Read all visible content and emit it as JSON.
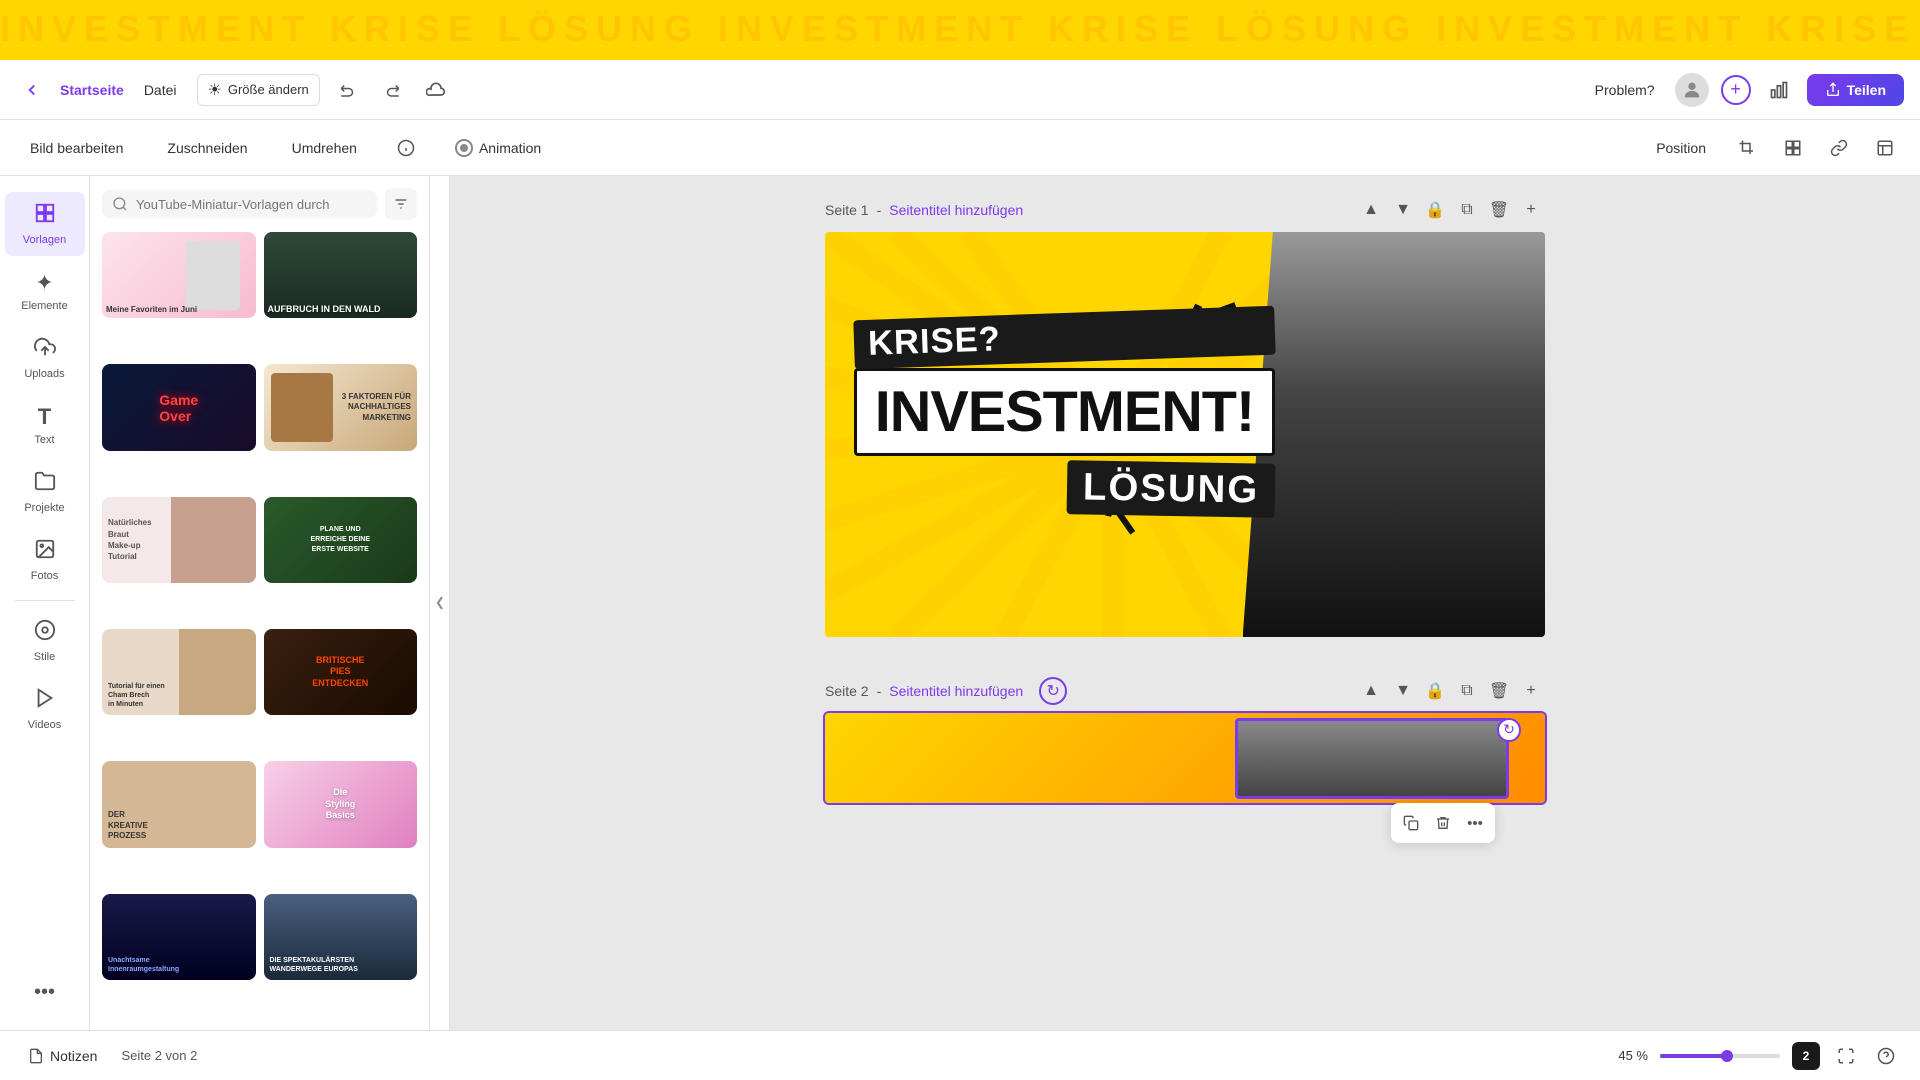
{
  "topBar": {
    "bgText": "INVESTMENT KRISE LÖSUNG INVESTMENT KRISE LÖSUNG INVESTMENT KRISE LÖSUNG"
  },
  "header": {
    "homeLabel": "Startseite",
    "fileLabel": "Datei",
    "sizeLabel": "Größe ändern",
    "problemLabel": "Problem?",
    "shareLabel": "Teilen"
  },
  "toolbar": {
    "editImageLabel": "Bild bearbeiten",
    "cropLabel": "Zuschneiden",
    "flipLabel": "Umdrehen",
    "animationLabel": "Animation",
    "positionLabel": "Position"
  },
  "sidebar": {
    "items": [
      {
        "id": "vorlagen",
        "label": "Vorlagen",
        "icon": "⊞",
        "active": true
      },
      {
        "id": "elemente",
        "label": "Elemente",
        "icon": "✦"
      },
      {
        "id": "uploads",
        "label": "Uploads",
        "icon": "⬆"
      },
      {
        "id": "text",
        "label": "Text",
        "icon": "T"
      },
      {
        "id": "projekte",
        "label": "Projekte",
        "icon": "📁"
      },
      {
        "id": "fotos",
        "label": "Fotos",
        "icon": "🖼"
      },
      {
        "id": "stile",
        "label": "Stile",
        "icon": "🎨"
      },
      {
        "id": "videos",
        "label": "Videos",
        "icon": "▶"
      }
    ]
  },
  "contentPanel": {
    "searchPlaceholder": "YouTube-Miniatur-Vorlagen durch",
    "templates": [
      {
        "id": 1,
        "cls": "tc1",
        "label": "Meine Favoriten im Juni"
      },
      {
        "id": 2,
        "cls": "tc2",
        "label": "AUFBRUCH IN DEN WALD"
      },
      {
        "id": 3,
        "cls": "tc3",
        "label": "Game Over"
      },
      {
        "id": 4,
        "cls": "tc4",
        "label": "3 FAKTOREN FÜR NACHHALTIGES MARKETING"
      },
      {
        "id": 5,
        "cls": "tc5",
        "label": "Natürliches Braut Make-up Tutorial"
      },
      {
        "id": 6,
        "cls": "tc8",
        "label": "PLANE UND ERREICHE DEINE ERSTE WEBSITE"
      },
      {
        "id": 7,
        "cls": "tc7",
        "label": "Tutorial für einen Cham Brech in Minuten"
      },
      {
        "id": 8,
        "cls": "tc9",
        "label": "BRITISCHE PIES ENTDECKEN"
      },
      {
        "id": 9,
        "cls": "tc10",
        "label": "DER KREATIVE PROZESS"
      },
      {
        "id": 10,
        "cls": "tc11",
        "label": "Die Styling Basics"
      },
      {
        "id": 11,
        "cls": "tc12",
        "label": "Unachtsame Innenraumgestaltung"
      },
      {
        "id": 12,
        "cls": "tc6",
        "label": "DIE SPEKTAKULÄRSTEN WANDERWEGE EUROPAS"
      }
    ]
  },
  "pages": [
    {
      "id": 1,
      "titleLabel": "Seite 1",
      "separator": " - ",
      "addTitleLabel": "Seitentitel hinzufügen",
      "canvas": {
        "texts": {
          "krise": "KRISE?",
          "investment": "INVESTMENT!",
          "loesung": "LÖSUNG"
        }
      }
    },
    {
      "id": 2,
      "titleLabel": "Seite 2",
      "separator": " - ",
      "addTitleLabel": "Seitentitel hinzufügen"
    }
  ],
  "bottomBar": {
    "notesLabel": "Notizen",
    "pageIndicator": "Seite 2 von 2",
    "zoomLevel": "45 %",
    "pageNum": "2"
  },
  "floatToolbar": {
    "copyLabel": "Kopieren",
    "deleteLabel": "Löschen",
    "moreLabel": "Mehr"
  }
}
